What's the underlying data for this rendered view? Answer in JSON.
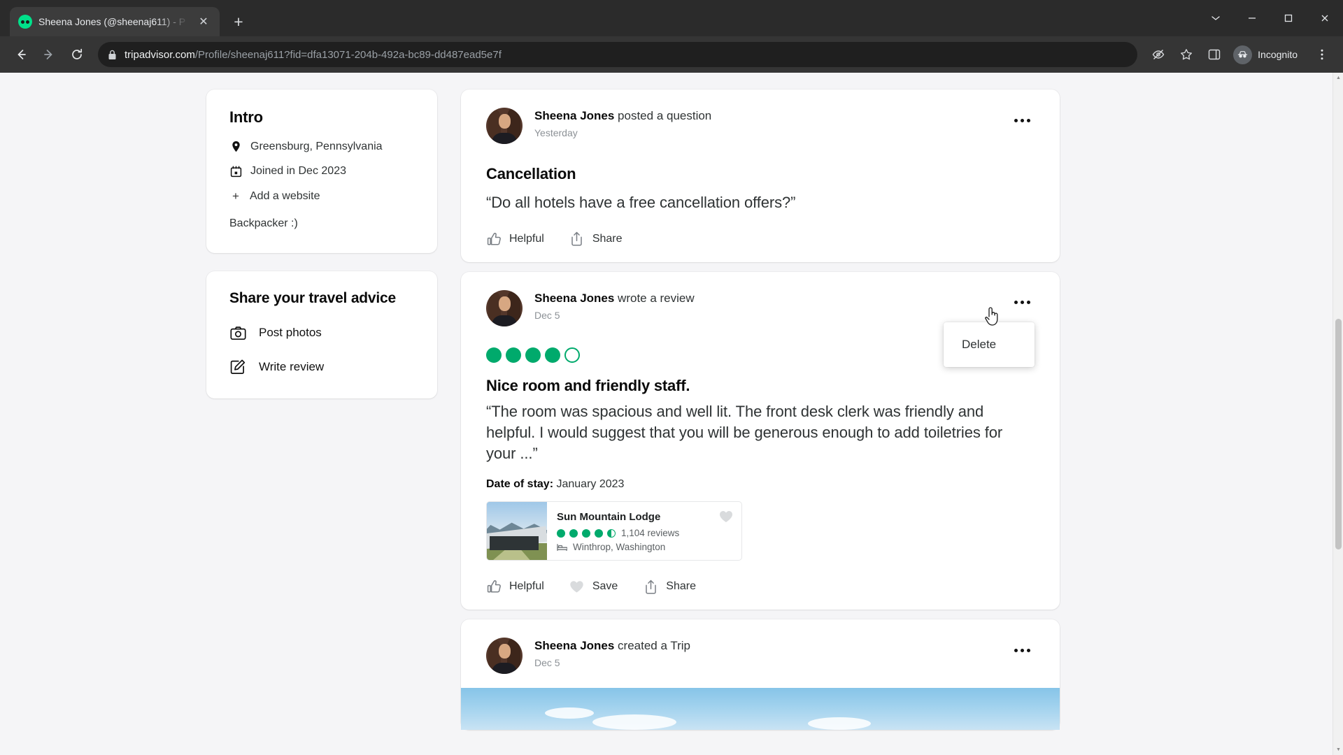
{
  "browser": {
    "tab": {
      "title": "Sheena Jones (@sheenaj611) - P",
      "favicon_name": "tripadvisor-owl-icon",
      "close_label": "✕"
    },
    "new_tab_label": "+",
    "window_controls": {
      "minimize": "─",
      "maximize": "☐",
      "close": "✕",
      "tab_search": "⌄"
    },
    "nav": {
      "back": "←",
      "forward": "→",
      "reload": "↻"
    },
    "omnibox": {
      "host": "tripadvisor.com",
      "path": "/Profile/sheenaj611?fid=dfa13071-204b-492a-bc89-dd487ead5e7f",
      "lock_icon": "lock-icon"
    },
    "toolbar_right": {
      "third_party_cookies_icon": "eye-slash-icon",
      "bookmark_icon": "star-icon",
      "side_panel_icon": "side-panel-icon",
      "profile_label": "Incognito",
      "menu_icon": "three-dot-menu-icon"
    }
  },
  "sidebar": {
    "intro": {
      "title": "Intro",
      "rows": [
        {
          "icon": "map-pin-icon",
          "text": "Greensburg, Pennsylvania"
        },
        {
          "icon": "calendar-icon",
          "text": "Joined in Dec 2023"
        }
      ],
      "add_website_label": "Add a website",
      "add_website_plus": "+",
      "bio": "Backpacker :)"
    },
    "advice": {
      "title": "Share your travel advice",
      "items": [
        {
          "icon": "camera-icon",
          "label": "Post photos"
        },
        {
          "icon": "pencil-square-icon",
          "label": "Write review"
        }
      ]
    }
  },
  "feed": {
    "question_post": {
      "author": "Sheena Jones",
      "action": " posted a question",
      "date": "Yesterday",
      "title": "Cancellation",
      "body": "“Do all hotels have a free cancellation offers?”",
      "actions": [
        {
          "icon": "thumbs-up-icon",
          "label": "Helpful"
        },
        {
          "icon": "share-icon",
          "label": "Share"
        }
      ],
      "overflow_icon": "three-dot-overflow-icon"
    },
    "review_post": {
      "author": "Sheena Jones",
      "action": " wrote a review",
      "date": "Dec 5",
      "rating": 4,
      "rating_max": 5,
      "title": "Nice room and friendly staff.",
      "body": "“The room was spacious and well lit. The front desk clerk was friendly and helpful. I would suggest that you will be generous enough to add toiletries for your ...”",
      "stay_label": "Date of stay:",
      "stay_value": "January 2023",
      "hotel": {
        "name": "Sun Mountain Lodge",
        "rating": 4.5,
        "reviews": "1,104 reviews",
        "location": "Winthrop, Washington",
        "location_icon": "bed-icon",
        "save_icon": "heart-icon"
      },
      "actions": [
        {
          "icon": "thumbs-up-icon",
          "label": "Helpful"
        },
        {
          "icon": "heart-icon",
          "label": "Save"
        },
        {
          "icon": "share-icon",
          "label": "Share"
        }
      ],
      "overflow_icon": "three-dot-overflow-icon",
      "menu": {
        "items": [
          "Delete"
        ]
      }
    },
    "trip_post": {
      "author": "Sheena Jones",
      "action": " created a Trip",
      "date": "Dec 5",
      "overflow_icon": "three-dot-overflow-icon"
    }
  },
  "colors": {
    "brand_green": "#00aa6c",
    "text_primary": "#0a0a0a",
    "text_secondary": "#2f3334",
    "text_muted": "#8c9196",
    "page_bg": "#f5f5f7",
    "chrome_bg": "#353535"
  }
}
